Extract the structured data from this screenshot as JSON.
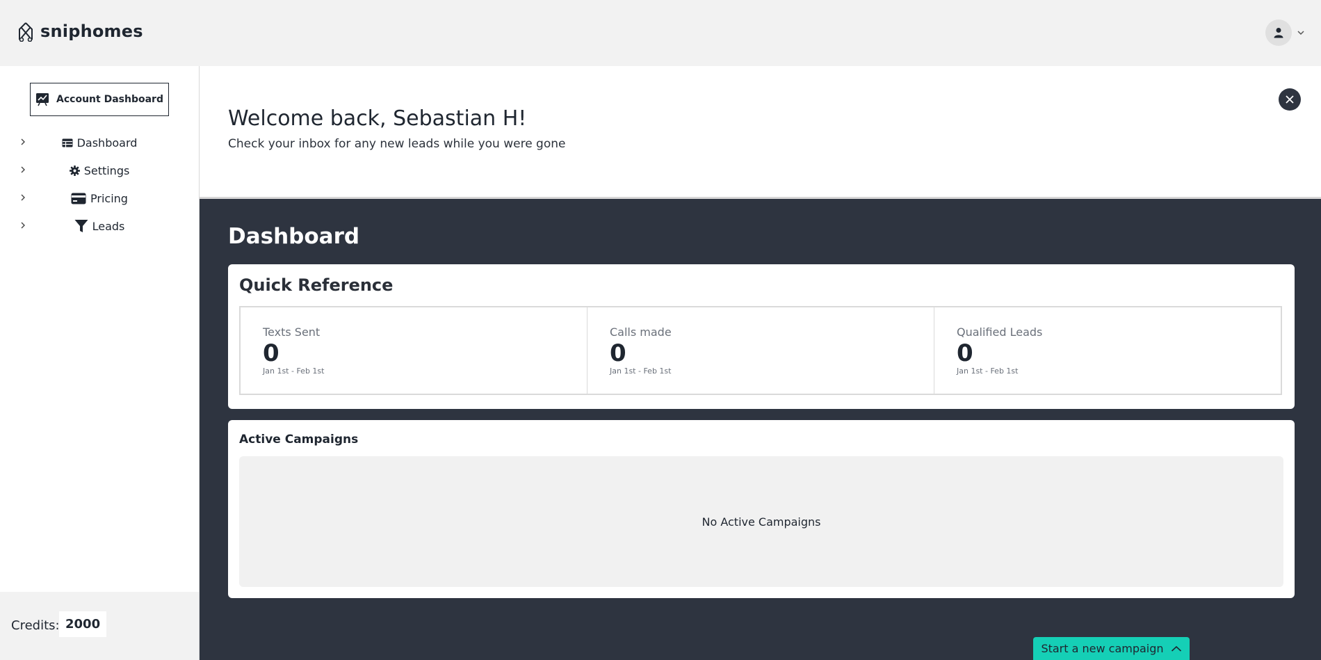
{
  "header": {
    "brand_name": "sniphomes",
    "logo_icon": "brand-logo-icon",
    "user_icon": "user-icon",
    "menu_icon": "chevron-down-icon"
  },
  "sidebar": {
    "account_dashboard_label": "Account Dashboard",
    "items": [
      {
        "label": "Dashboard",
        "icon": "table-icon"
      },
      {
        "label": "Settings",
        "icon": "gear-icon"
      },
      {
        "label": "Pricing",
        "icon": "credit-card-icon"
      },
      {
        "label": "Leads",
        "icon": "filter-icon"
      }
    ],
    "credits_label": "Credits:",
    "credits_value": "2000"
  },
  "welcome": {
    "title": "Welcome back, Sebastian H!",
    "subtitle": "Check your inbox for any new leads while you were gone"
  },
  "dashboard": {
    "title": "Dashboard",
    "quick_reference": {
      "title": "Quick Reference",
      "stats": [
        {
          "label": "Texts Sent",
          "value": "0",
          "range": "Jan 1st - Feb 1st"
        },
        {
          "label": "Calls made",
          "value": "0",
          "range": "Jan 1st - Feb 1st"
        },
        {
          "label": "Qualified Leads",
          "value": "0",
          "range": "Jan 1st - Feb 1st"
        }
      ]
    },
    "active_campaigns": {
      "title": "Active Campaigns",
      "empty_text": "No Active Campaigns"
    },
    "start_campaign_label": "Start a new campaign"
  },
  "colors": {
    "dark": "#2e3440",
    "accent": "#15cfb6",
    "light_bg": "#f2f2f2"
  }
}
